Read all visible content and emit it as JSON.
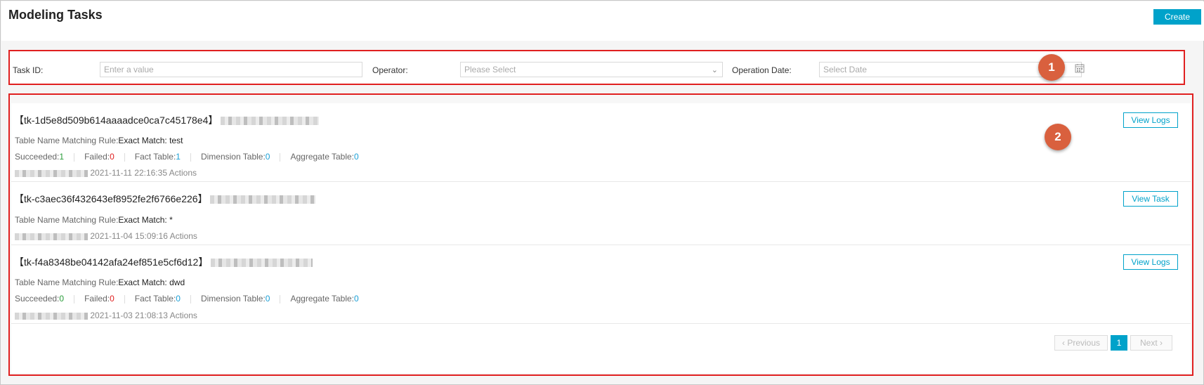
{
  "page": {
    "title": "Modeling Tasks",
    "create_label": "Create"
  },
  "filters": {
    "task_id_label": "Task ID:",
    "task_id_placeholder": "Enter a value",
    "operator_label": "Operator:",
    "operator_placeholder": "Please Select",
    "date_label": "Operation Date:",
    "date_placeholder": "Select Date"
  },
  "callouts": [
    "1",
    "2"
  ],
  "tasks": [
    {
      "id": "【tk-1d5e8d509b614aaaadce0ca7c45178e4】",
      "rule_label": "Table Name Matching Rule:",
      "rule_value": "Exact Match: test",
      "stats": {
        "succeeded_label": "Succeeded:",
        "succeeded": "1",
        "failed_label": "Failed:",
        "failed": "0",
        "fact_label": "Fact Table:",
        "fact": "1",
        "dimension_label": "Dimension Table:",
        "dimension": "0",
        "aggregate_label": "Aggregate Table:",
        "aggregate": "0"
      },
      "time": "2021-11-11 22:16:35",
      "actions": "Actions",
      "button": "View Logs"
    },
    {
      "id": "【tk-c3aec36f432643ef8952fe2f6766e226】",
      "rule_label": "Table Name Matching Rule:",
      "rule_value": "Exact Match: *",
      "time": "2021-11-04 15:09:16",
      "actions": "Actions",
      "button": "View Task"
    },
    {
      "id": "【tk-f4a8348be04142afa24ef851e5cf6d12】",
      "rule_label": "Table Name Matching Rule:",
      "rule_value": "Exact Match: dwd",
      "stats": {
        "succeeded_label": "Succeeded:",
        "succeeded": "0",
        "failed_label": "Failed:",
        "failed": "0",
        "fact_label": "Fact Table:",
        "fact": "0",
        "dimension_label": "Dimension Table:",
        "dimension": "0",
        "aggregate_label": "Aggregate Table:",
        "aggregate": "0"
      },
      "time": "2021-11-03 21:08:13",
      "actions": "Actions",
      "button": "View Logs"
    }
  ],
  "pagination": {
    "previous": "Previous",
    "current": "1",
    "next": "Next"
  },
  "colors": {
    "accent": "#00a2ca",
    "highlight": "#e02020",
    "callout": "#d9603e"
  }
}
